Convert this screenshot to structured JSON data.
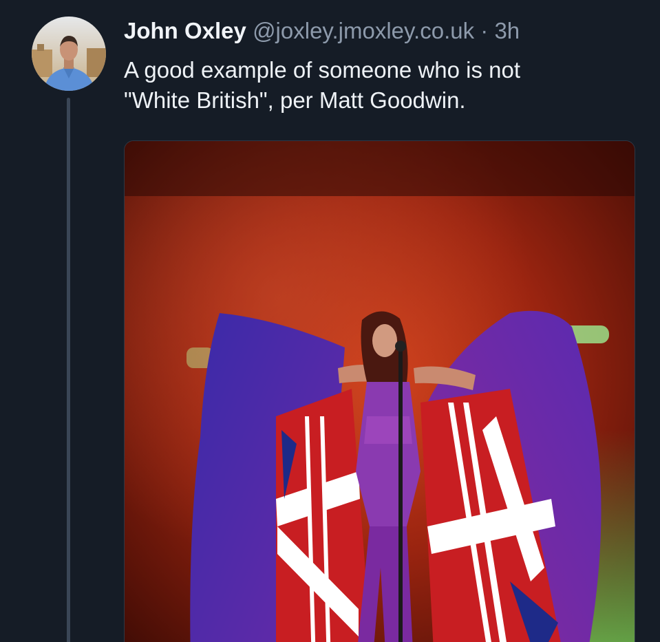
{
  "post": {
    "author": {
      "display_name": "John Oxley",
      "handle": "@joxley.jmoxley.co.uk",
      "avatar_icon": "profile-photo-icon"
    },
    "separator": "·",
    "timestamp": "3h",
    "text_lines": [
      "A good example of someone who is not",
      "\"White British\", per Matt Goodwin."
    ],
    "media": {
      "type": "photo",
      "icon": "concert-photo"
    }
  },
  "colors": {
    "background": "#151c26",
    "thread_line": "#3a4656",
    "name": "#f1f4f8",
    "muted": "#8d9aab"
  }
}
